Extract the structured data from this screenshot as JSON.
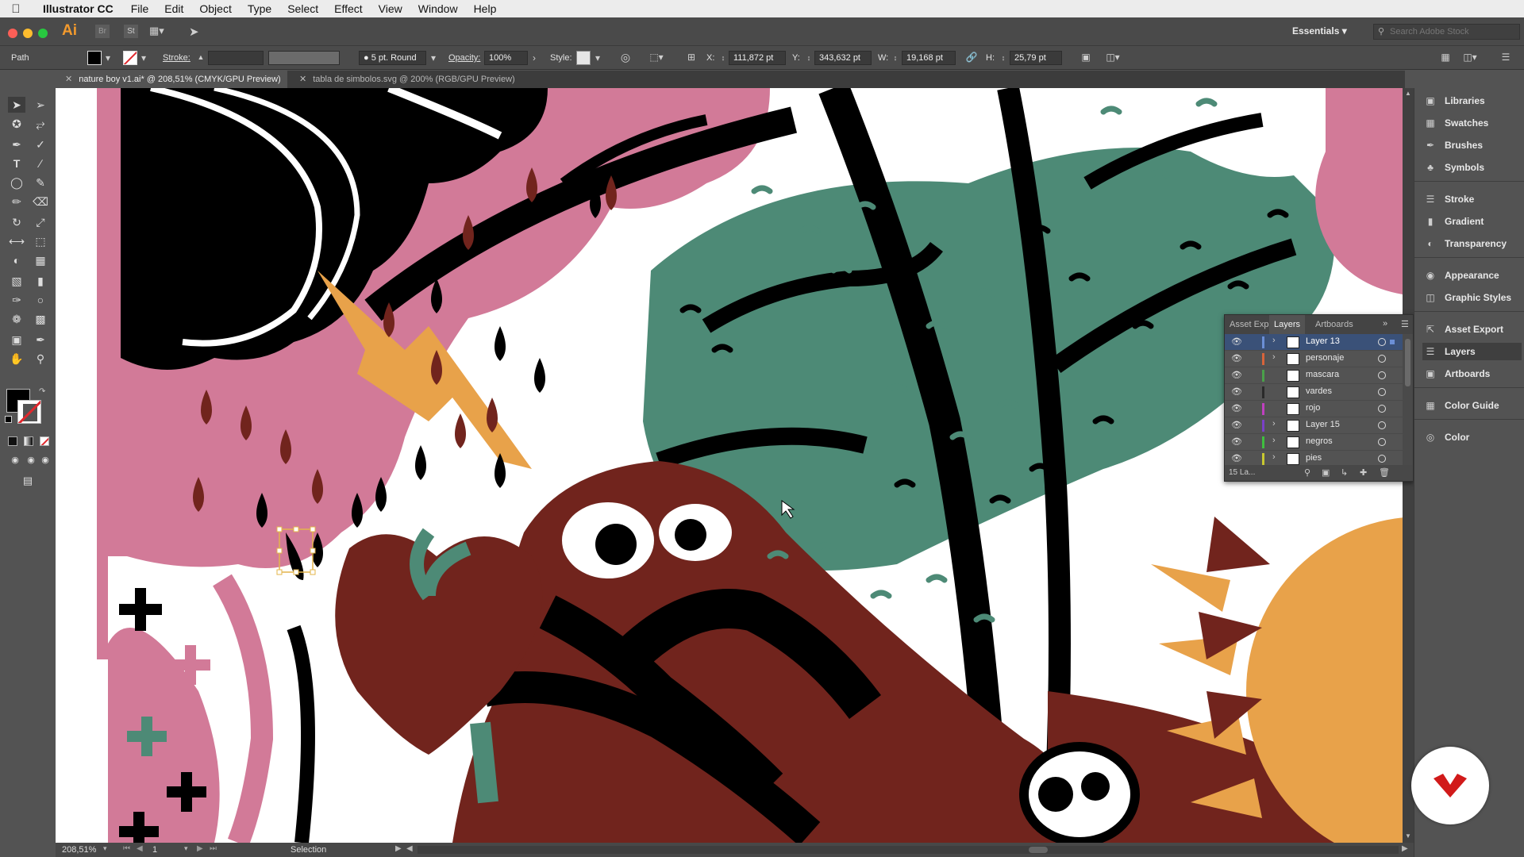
{
  "menubar": {
    "app_name": "Illustrator CC",
    "items": [
      "File",
      "Edit",
      "Object",
      "Type",
      "Select",
      "Effect",
      "View",
      "Window",
      "Help"
    ]
  },
  "appbar": {
    "logo": "Ai",
    "bridge": "Br",
    "stock": "St",
    "workspace": "Essentials",
    "search_placeholder": "Search Adobe Stock"
  },
  "control": {
    "selection_type": "Path",
    "stroke_label": "Stroke:",
    "brush": "5 pt. Round",
    "opacity_label": "Opacity:",
    "opacity_value": "100%",
    "style_label": "Style:",
    "x_label": "X:",
    "x_value": "111,872 pt",
    "y_label": "Y:",
    "y_value": "343,632 pt",
    "w_label": "W:",
    "w_value": "19,168 pt",
    "h_label": "H:",
    "h_value": "25,79 pt"
  },
  "tabs": [
    {
      "label": "nature boy v1.ai* @ 208,51% (CMYK/GPU Preview)",
      "active": true
    },
    {
      "label": "tabla de simbolos.svg @ 200% (RGB/GPU Preview)",
      "active": false
    }
  ],
  "status": {
    "zoom": "208,51%",
    "artboard": "1",
    "tool": "Selection"
  },
  "dock": {
    "groups": [
      [
        {
          "label": "Libraries",
          "icon": "libraries-icon"
        },
        {
          "label": "Swatches",
          "icon": "swatches-icon"
        },
        {
          "label": "Brushes",
          "icon": "brushes-icon"
        },
        {
          "label": "Symbols",
          "icon": "symbols-icon"
        }
      ],
      [
        {
          "label": "Stroke",
          "icon": "stroke-icon"
        },
        {
          "label": "Gradient",
          "icon": "gradient-icon"
        },
        {
          "label": "Transparency",
          "icon": "transparency-icon"
        }
      ],
      [
        {
          "label": "Appearance",
          "icon": "appearance-icon"
        },
        {
          "label": "Graphic Styles",
          "icon": "graphic-styles-icon"
        }
      ],
      [
        {
          "label": "Asset Export",
          "icon": "asset-export-icon"
        },
        {
          "label": "Layers",
          "icon": "layers-icon",
          "active": true
        },
        {
          "label": "Artboards",
          "icon": "artboards-icon"
        }
      ],
      [
        {
          "label": "Color Guide",
          "icon": "color-guide-icon"
        }
      ],
      [
        {
          "label": "Color",
          "icon": "color-icon"
        }
      ]
    ]
  },
  "layers_panel": {
    "tabs": [
      "Asset Expo",
      "Layers",
      "Artboards"
    ],
    "active_tab": "Layers",
    "layers": [
      {
        "name": "Layer 13",
        "color": "#6b8fd6",
        "expandable": true,
        "selected": true
      },
      {
        "name": "personaje",
        "color": "#d8643a",
        "expandable": true,
        "selected": false
      },
      {
        "name": "mascara",
        "color": "#4aa04a",
        "expandable": false,
        "selected": false
      },
      {
        "name": "vardes",
        "color": "#2a2a2a",
        "expandable": false,
        "selected": false
      },
      {
        "name": "rojo",
        "color": "#c040c0",
        "expandable": false,
        "selected": false
      },
      {
        "name": "Layer 15",
        "color": "#7a40c8",
        "expandable": true,
        "selected": false
      },
      {
        "name": "negros",
        "color": "#3fbf3f",
        "expandable": true,
        "selected": false
      },
      {
        "name": "pies",
        "color": "#c8c830",
        "expandable": true,
        "selected": false
      }
    ],
    "count_label": "15 La..."
  },
  "colors": {
    "pink": "#d27a98",
    "teal": "#4d8a76",
    "maroon": "#71241d",
    "orange": "#e8a24a",
    "black": "#000000",
    "white": "#ffffff",
    "selection": "#e3b44a",
    "brand_red": "#d11a1a"
  }
}
